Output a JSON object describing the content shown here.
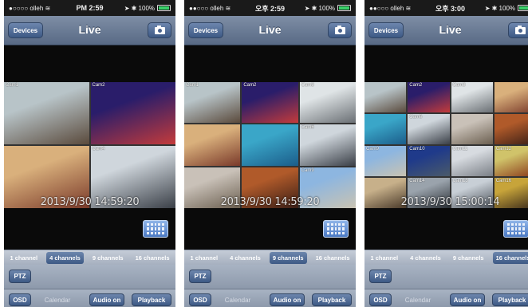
{
  "screens": [
    {
      "status": {
        "carrier": "●○○○○ olleh ≋",
        "time": "PM 2:59",
        "right": "➤ ✱ 100%",
        "battery": 1.0
      },
      "navbar": {
        "devices": "Devices",
        "title": "Live"
      },
      "grid": {
        "cols": 2,
        "tiles": [
          {
            "label": "Cam1",
            "c1": "#b8c4c8",
            "c2": "#5a4a3c"
          },
          {
            "label": "Cam2",
            "c1": "#2a1d6a",
            "c2": "#c43b3b"
          },
          {
            "label": "",
            "c1": "#d9b07c",
            "c2": "#7a3a2a"
          },
          {
            "label": "Cam4",
            "c1": "#cfd6dc",
            "c2": "#3a3f47"
          }
        ]
      },
      "timestamp": "2013/9/30 14:59:20",
      "channels": [
        {
          "label": "1 channel",
          "on": false
        },
        {
          "label": "4 channels",
          "on": true
        },
        {
          "label": "9 channels",
          "on": false
        },
        {
          "label": "16 channels",
          "on": false
        }
      ],
      "ptz": "PTZ",
      "bottom": {
        "osd": "OSD",
        "calendar": "Calendar",
        "audio": "Audio on",
        "playback": "Playback"
      }
    },
    {
      "status": {
        "carrier": "●●○○○ olleh ≋",
        "time": "오후 2:59",
        "right": "➤ ✱ 100%",
        "battery": 1.0
      },
      "navbar": {
        "devices": "Devices",
        "title": "Live"
      },
      "grid": {
        "cols": 3,
        "tiles": [
          {
            "label": "Cam1",
            "c1": "#b8c4c8",
            "c2": "#5a4a3c"
          },
          {
            "label": "Cam2",
            "c1": "#2a1d6a",
            "c2": "#c43b3b"
          },
          {
            "label": "Cam3",
            "c1": "#dfe4e6",
            "c2": "#6a6f74"
          },
          {
            "label": "",
            "c1": "#d9b07c",
            "c2": "#7a3a2a"
          },
          {
            "label": "",
            "c1": "#3aa6c8",
            "c2": "#1b5d8a"
          },
          {
            "label": "Cam6",
            "c1": "#cfd6dc",
            "c2": "#3a3f47"
          },
          {
            "label": "",
            "c1": "#c9c1b8",
            "c2": "#6b5f50"
          },
          {
            "label": "",
            "c1": "#b05a2a",
            "c2": "#3a1e16"
          },
          {
            "label": "Cam9",
            "c1": "#8db6e0",
            "c2": "#c9c3b2"
          }
        ]
      },
      "timestamp": "2013/9/30 14:59:20",
      "channels": [
        {
          "label": "1 channel",
          "on": false
        },
        {
          "label": "4 channels",
          "on": false
        },
        {
          "label": "9 channels",
          "on": true
        },
        {
          "label": "16 channels",
          "on": false
        }
      ],
      "ptz": "PTZ",
      "bottom": {
        "osd": "OSD",
        "calendar": "Calendar",
        "audio": "Audio on",
        "playback": "Playback"
      }
    },
    {
      "status": {
        "carrier": "●●○○○ olleh ≋",
        "time": "오후 3:00",
        "right": "➤ ✱ 100%",
        "battery": 1.0
      },
      "navbar": {
        "devices": "Devices",
        "title": "Live"
      },
      "grid": {
        "cols": 4,
        "tiles": [
          {
            "label": "",
            "c1": "#b8c4c8",
            "c2": "#5a4a3c"
          },
          {
            "label": "Cam2",
            "c1": "#2a1d6a",
            "c2": "#c43b3b"
          },
          {
            "label": "Cam3",
            "c1": "#dfe4e6",
            "c2": "#6a6f74"
          },
          {
            "label": "",
            "c1": "#d9b07c",
            "c2": "#7a3a2a"
          },
          {
            "label": "",
            "c1": "#3aa6c8",
            "c2": "#1b5d8a"
          },
          {
            "label": "Cam6",
            "c1": "#cfd6dc",
            "c2": "#3a3f47"
          },
          {
            "label": "",
            "c1": "#c9c1b8",
            "c2": "#6b5f50"
          },
          {
            "label": "",
            "c1": "#b05a2a",
            "c2": "#3a1e16"
          },
          {
            "label": "Cam9",
            "c1": "#8db6e0",
            "c2": "#c9c3b2"
          },
          {
            "label": "Cam10",
            "c1": "#1f3a8a",
            "c2": "#4a5a6a"
          },
          {
            "label": "Cam11",
            "c1": "#d7dbe0",
            "c2": "#7a7f86"
          },
          {
            "label": "Cam12",
            "c1": "#d0c36a",
            "c2": "#8a3a1a"
          },
          {
            "label": "",
            "c1": "#c7b08a",
            "c2": "#4a3a2a"
          },
          {
            "label": "Cam14",
            "c1": "#9aa3ac",
            "c2": "#2a2f35"
          },
          {
            "label": "Cam15",
            "c1": "#c8cfd6",
            "c2": "#4a5058"
          },
          {
            "label": "Cam16",
            "c1": "#c7a43a",
            "c2": "#3a2a1a"
          }
        ]
      },
      "timestamp": "2013/9/30 15:00:14",
      "channels": [
        {
          "label": "1 channel",
          "on": false
        },
        {
          "label": "4 channels",
          "on": false
        },
        {
          "label": "9 channels",
          "on": false
        },
        {
          "label": "16 channels",
          "on": true
        }
      ],
      "ptz": "PTZ",
      "bottom": {
        "osd": "OSD",
        "calendar": "Calendar",
        "audio": "Audio on",
        "playback": "Playback"
      }
    }
  ]
}
